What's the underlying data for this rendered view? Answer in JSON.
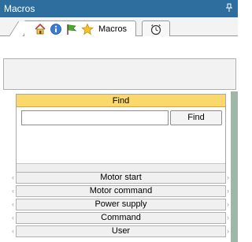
{
  "window": {
    "title": "Macros",
    "pin_glyph": "p"
  },
  "tabs": {
    "group_icons": [
      "home-icon",
      "info-icon",
      "flag-icon",
      "star-icon"
    ],
    "active_label": "Macros",
    "extra_tab_icon": "clock-icon"
  },
  "find_panel": {
    "header": "Find",
    "input_value": "",
    "button_label": "Find"
  },
  "macro_groups": [
    {
      "label": "Motor start"
    },
    {
      "label": "Motor command"
    },
    {
      "label": "Power supply"
    },
    {
      "label": "Command"
    },
    {
      "label": "User"
    }
  ],
  "colors": {
    "titlebar": "#2e6e9e",
    "find_header": "#fbd86c",
    "right_strip": "#9fb7a9"
  }
}
